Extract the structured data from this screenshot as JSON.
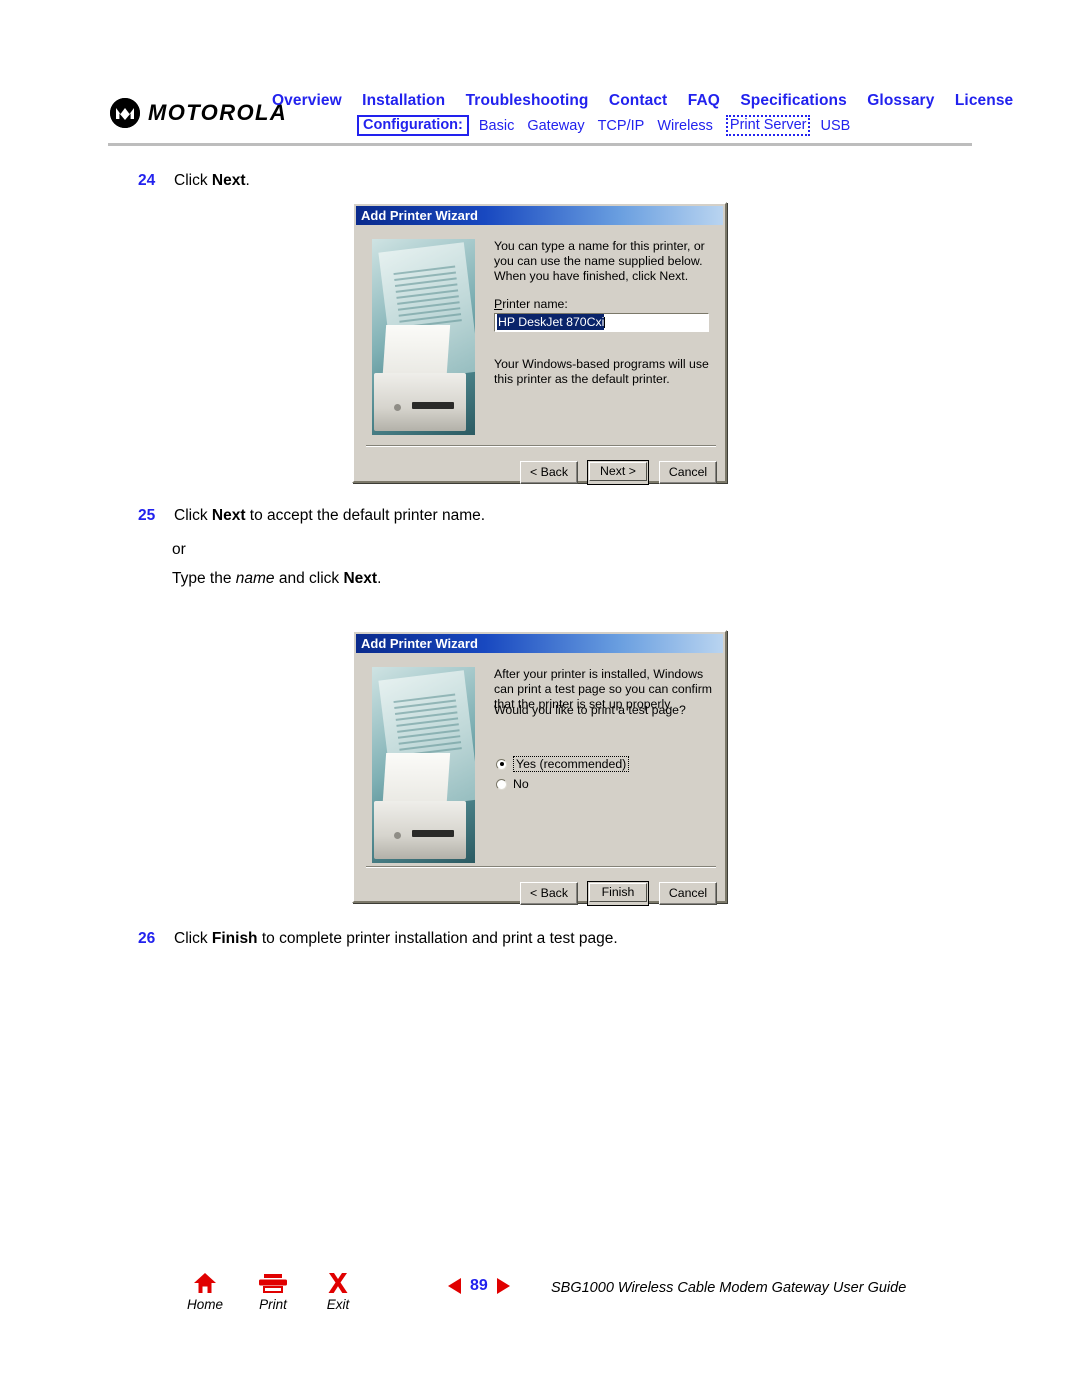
{
  "header": {
    "brand": "MOTOROLA",
    "brand_icon": "motorola-m-logo",
    "nav_primary": [
      "Overview",
      "Installation",
      "Troubleshooting",
      "Contact",
      "FAQ",
      "Specifications",
      "Glossary",
      "License"
    ],
    "config_label": "Configuration:",
    "nav_secondary": [
      "Basic",
      "Gateway",
      "TCP/IP",
      "Wireless",
      "Print Server",
      "USB"
    ],
    "nav_secondary_active": "Print Server",
    "link_color": "#2222ee"
  },
  "steps": {
    "step24": {
      "num": "24",
      "text_pre": "Click ",
      "bold": "Next",
      "text_post": "."
    },
    "step25": {
      "num": "25",
      "text_pre": "Click ",
      "bold": "Next",
      "text_post": " to accept the default printer name.",
      "or_text": "or",
      "alt_pre": "Type the ",
      "alt_italic": "name",
      "alt_mid": " and click ",
      "alt_bold": "Next",
      "alt_post": "."
    },
    "step26": {
      "num": "26",
      "text_pre": "Click ",
      "bold": "Finish",
      "text_post": " to complete printer installation and print a test page."
    }
  },
  "dialog1": {
    "title": "Add Printer Wizard",
    "image_alt": "printer-photo",
    "paragraph1": "You can type a name for this printer, or you can use the name supplied below. When you have finished, click Next.",
    "field_label": "Printer name:",
    "field_value": "HP DeskJet 870Cxi",
    "field_value_selected": true,
    "paragraph2": "Your Windows-based programs will use this printer as the default printer.",
    "buttons": [
      {
        "label": "< Back",
        "default": false
      },
      {
        "label": "Next >",
        "default": true
      },
      {
        "label": "Cancel",
        "default": false
      }
    ]
  },
  "dialog2": {
    "title": "Add Printer Wizard",
    "image_alt": "printer-photo",
    "paragraph1": "After your printer is installed, Windows can print a test page so you can confirm that the printer is set up properly.",
    "paragraph2": "Would you like to print a test page?",
    "radios": [
      {
        "label": "Yes (recommended)",
        "checked": true,
        "focused": true
      },
      {
        "label": "No",
        "checked": false,
        "focused": false
      }
    ],
    "buttons": [
      {
        "label": "< Back",
        "default": false
      },
      {
        "label": "Finish",
        "default": true
      },
      {
        "label": "Cancel",
        "default": false
      }
    ]
  },
  "footer": {
    "items": [
      {
        "label": "Home",
        "icon": "home-icon"
      },
      {
        "label": "Print",
        "icon": "printer-icon"
      },
      {
        "label": "Exit",
        "icon": "exit-x-icon"
      }
    ],
    "page_number": "89",
    "prev_icon": "left-triangle-icon",
    "next_icon": "right-triangle-icon",
    "doc_title": "SBG1000 Wireless Cable Modem Gateway User Guide",
    "icon_color": "#e00000",
    "page_number_color": "#2222ee"
  }
}
